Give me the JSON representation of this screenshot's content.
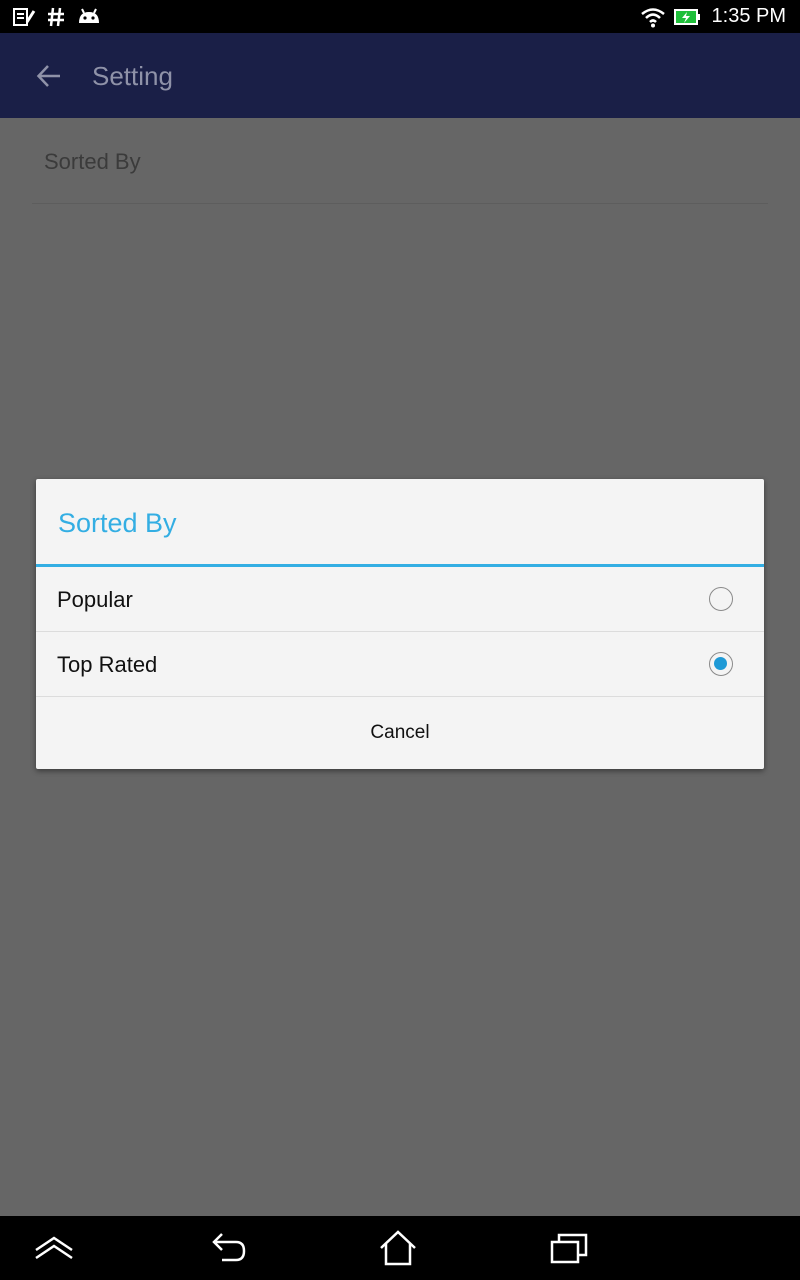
{
  "status_bar": {
    "time": "1:35 PM",
    "icons": [
      "notes-icon",
      "hash-icon",
      "android-icon",
      "wifi-icon",
      "battery-charging-icon"
    ]
  },
  "app_bar": {
    "title": "Setting",
    "back_icon": "arrow-left-icon"
  },
  "settings": {
    "items": [
      {
        "label": "Sorted By"
      }
    ]
  },
  "dialog": {
    "title": "Sorted By",
    "options": [
      {
        "label": "Popular",
        "selected": false
      },
      {
        "label": "Top Rated",
        "selected": true
      }
    ],
    "cancel_label": "Cancel"
  },
  "nav_bar": {
    "buttons": [
      "expand-icon",
      "back-icon",
      "home-icon",
      "recent-apps-icon"
    ]
  },
  "colors": {
    "accent": "#33aee3",
    "app_bar": "#1a1f47",
    "scrim_background": "#666666",
    "radio_selected": "#1f9ad6"
  }
}
